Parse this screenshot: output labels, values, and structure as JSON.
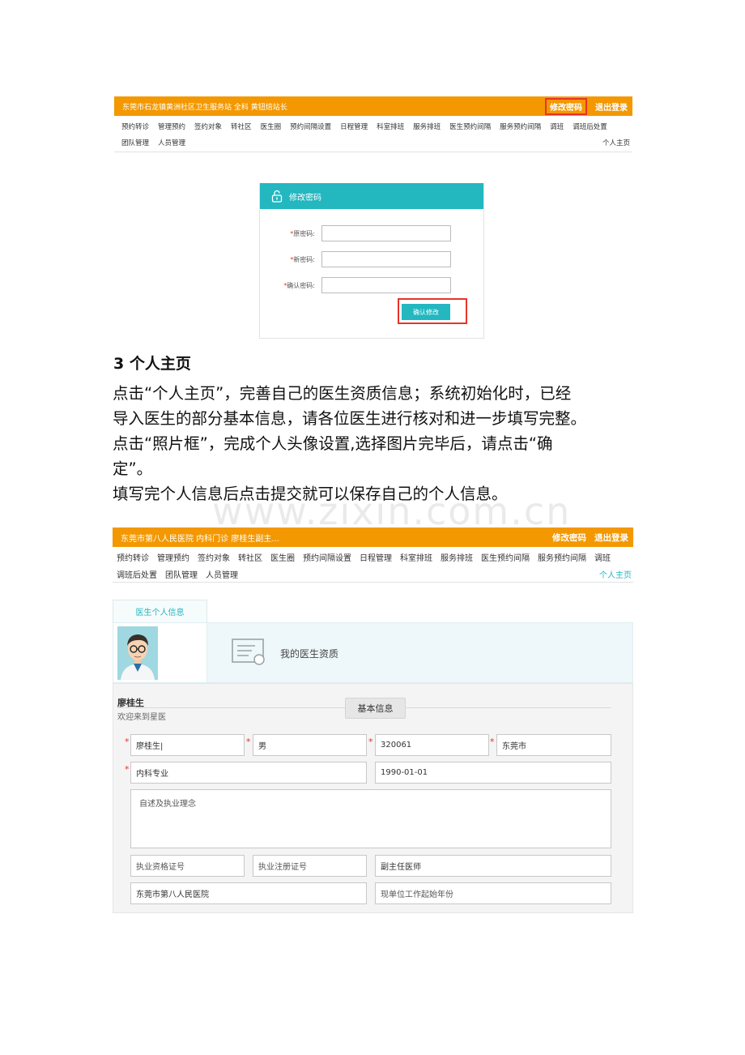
{
  "shot1": {
    "header_title": "东莞市石龙镇黄洲社区卫生服务站 全科 黄钮焙站长",
    "change_password": "修改密码",
    "logout": "退出登录",
    "nav": [
      "预约转诊",
      "管理预约",
      "签约对象",
      "转社区",
      "医生圈",
      "预约间隔设置",
      "日程管理",
      "科室排班",
      "服务排班",
      "医生预约间隔",
      "服务预约间隔",
      "调班",
      "调班后处置"
    ],
    "nav_row2": [
      "团队管理",
      "人员管理"
    ],
    "home_link": "个人主页",
    "panel_title": "修改密码",
    "fields": [
      {
        "required": "*",
        "label": "原密码:"
      },
      {
        "required": "*",
        "label": "新密码:"
      },
      {
        "required": "*",
        "label": "确认密码:"
      }
    ],
    "confirm_button": "确认修改"
  },
  "section": {
    "heading": "3  个人主页",
    "lines": [
      "点击“个人主页”，完善自己的医生资质信息；系统初始化时，已经",
      "导入医生的部分基本信息，请各位医生进行核对和进一步填写完整。",
      "点击“照片框”，完成个人头像设置,选择图片完毕后，请点击“确",
      "定”。",
      "填写完个人信息后点击提交就可以保存自己的个人信息。"
    ],
    "watermark": "www.zixin.com.cn"
  },
  "shot2": {
    "header_title": "东莞市第八人民医院 内科门诊 廖桂生副主...",
    "change_password": "修改密码",
    "logout": "退出登录",
    "nav": [
      "预约转诊",
      "管理预约",
      "签约对象",
      "转社区",
      "医生圈",
      "预约间隔设置",
      "日程管理",
      "科室排班",
      "服务排班",
      "医生预约间隔",
      "服务预约间隔",
      "调班"
    ],
    "nav_row2": [
      "调班后处置",
      "团队管理",
      "人员管理"
    ],
    "home_link": "个人主页",
    "tab_label": "医生个人信息",
    "qualification_label": "我的医生资质",
    "doctor_name": "廖桂生",
    "welcome": "欢迎来到星医",
    "basic_info_button": "基本信息",
    "form": {
      "name": "廖桂生|",
      "gender": "男",
      "code": "320061",
      "city": "东莞市",
      "specialty": "内科专业",
      "date": "1990-01-01",
      "statement_placeholder": "自述及执业理念",
      "license_qual_placeholder": "执业资格证号",
      "license_reg_placeholder": "执业注册证号",
      "title": "副主任医师",
      "unit": "东莞市第八人民医院",
      "start_year_placeholder": "现单位工作起始年份"
    },
    "required_mark": "*"
  },
  "colors": {
    "orange": "#f39800",
    "teal": "#23b7c0",
    "red": "#e8332a"
  }
}
